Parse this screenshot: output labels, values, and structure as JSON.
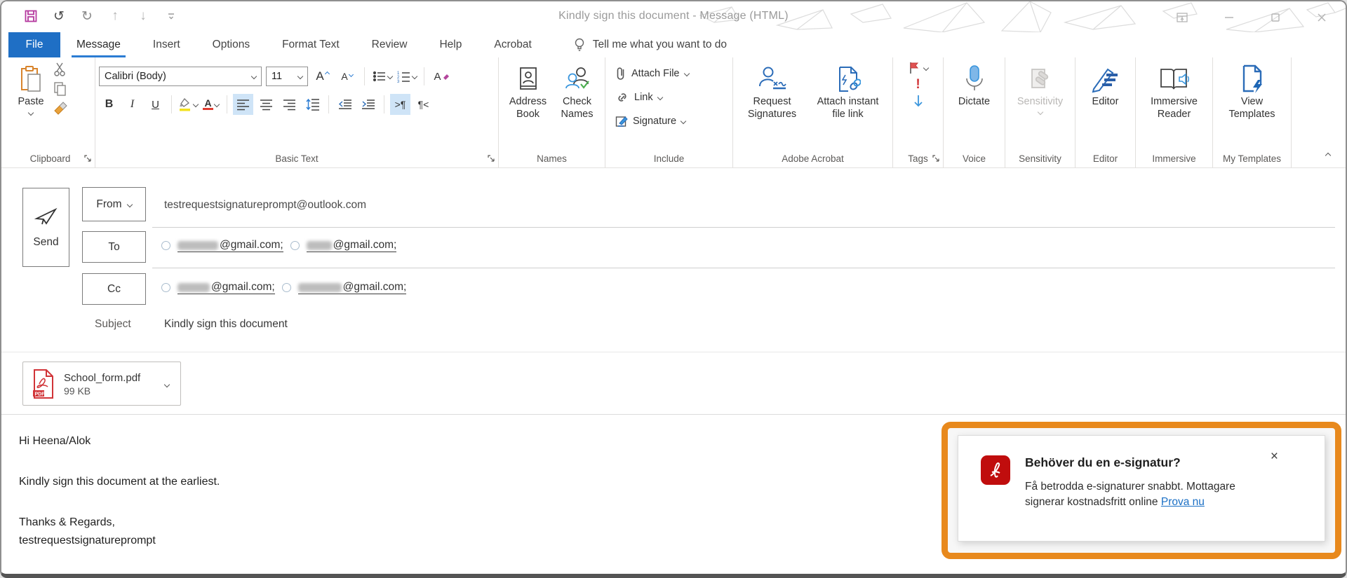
{
  "titlebar": {
    "title": "Kindly sign this document  -  Message (HTML)"
  },
  "tabs": {
    "file": "File",
    "message": "Message",
    "insert": "Insert",
    "options": "Options",
    "format_text": "Format Text",
    "review": "Review",
    "help": "Help",
    "acrobat": "Acrobat",
    "tell_me": "Tell me what you want to do"
  },
  "ribbon": {
    "clipboard": {
      "label": "Clipboard",
      "paste": "Paste"
    },
    "basic_text": {
      "label": "Basic Text",
      "font_name": "Calibri (Body)",
      "font_size": "11",
      "bold": "B",
      "italic": "I",
      "underline": "U"
    },
    "names": {
      "label": "Names",
      "address_book": "Address Book",
      "check_names": "Check Names"
    },
    "include": {
      "label": "Include",
      "attach_file": "Attach File",
      "link": "Link",
      "signature": "Signature"
    },
    "adobe_acrobat": {
      "label": "Adobe Acrobat",
      "request_signatures": "Request Signatures",
      "attach_instant": "Attach instant file link"
    },
    "tags": {
      "label": "Tags"
    },
    "voice": {
      "label": "Voice",
      "dictate": "Dictate"
    },
    "sensitivity": {
      "label": "Sensitivity",
      "button": "Sensitivity"
    },
    "editor": {
      "label": "Editor",
      "button": "Editor"
    },
    "immersive": {
      "label": "Immersive",
      "button": "Immersive Reader"
    },
    "templates": {
      "label": "My Templates",
      "button": "View Templates"
    }
  },
  "icons": {
    "para_ltr": ">¶",
    "para_rtl": "¶<",
    "importance_high": "!",
    "grow_font": "A",
    "shrink_font": "A",
    "font_color": "A",
    "clear_format": "A"
  },
  "envelope": {
    "send": "Send",
    "from_label": "From",
    "to_label": "To",
    "cc_label": "Cc",
    "from_value": "testrequestsignatureprompt@outlook.com",
    "subject_label": "Subject",
    "subject_value": "Kindly sign this document",
    "to_recipients": [
      {
        "domain": "@gmail.com;"
      },
      {
        "domain": "@gmail.com;"
      }
    ],
    "cc_recipients": [
      {
        "domain": "@gmail.com;"
      },
      {
        "domain": "@gmail.com;"
      }
    ]
  },
  "attachment": {
    "name": "School_form.pdf",
    "size": "99 KB",
    "badge": "PDF"
  },
  "body": {
    "line1": "Hi Heena/Alok",
    "line2": "Kindly sign this document at the earliest.",
    "line3": "Thanks & Regards,",
    "line4": "testrequestsignatureprompt"
  },
  "popup": {
    "title": "Behöver du en e-signatur?",
    "text": "Få betrodda e-signaturer snabbt. Mottagare signerar kostnadsfritt online ",
    "link": "Prova nu",
    "close": "×"
  },
  "colors": {
    "accent_blue": "#1f6fc5",
    "tab_underline": "#2b7cd3",
    "popup_orange": "#e8891d",
    "adobe_red": "#c00d0d",
    "pdf_red": "#d13438",
    "link_blue": "#1a6fc5"
  }
}
